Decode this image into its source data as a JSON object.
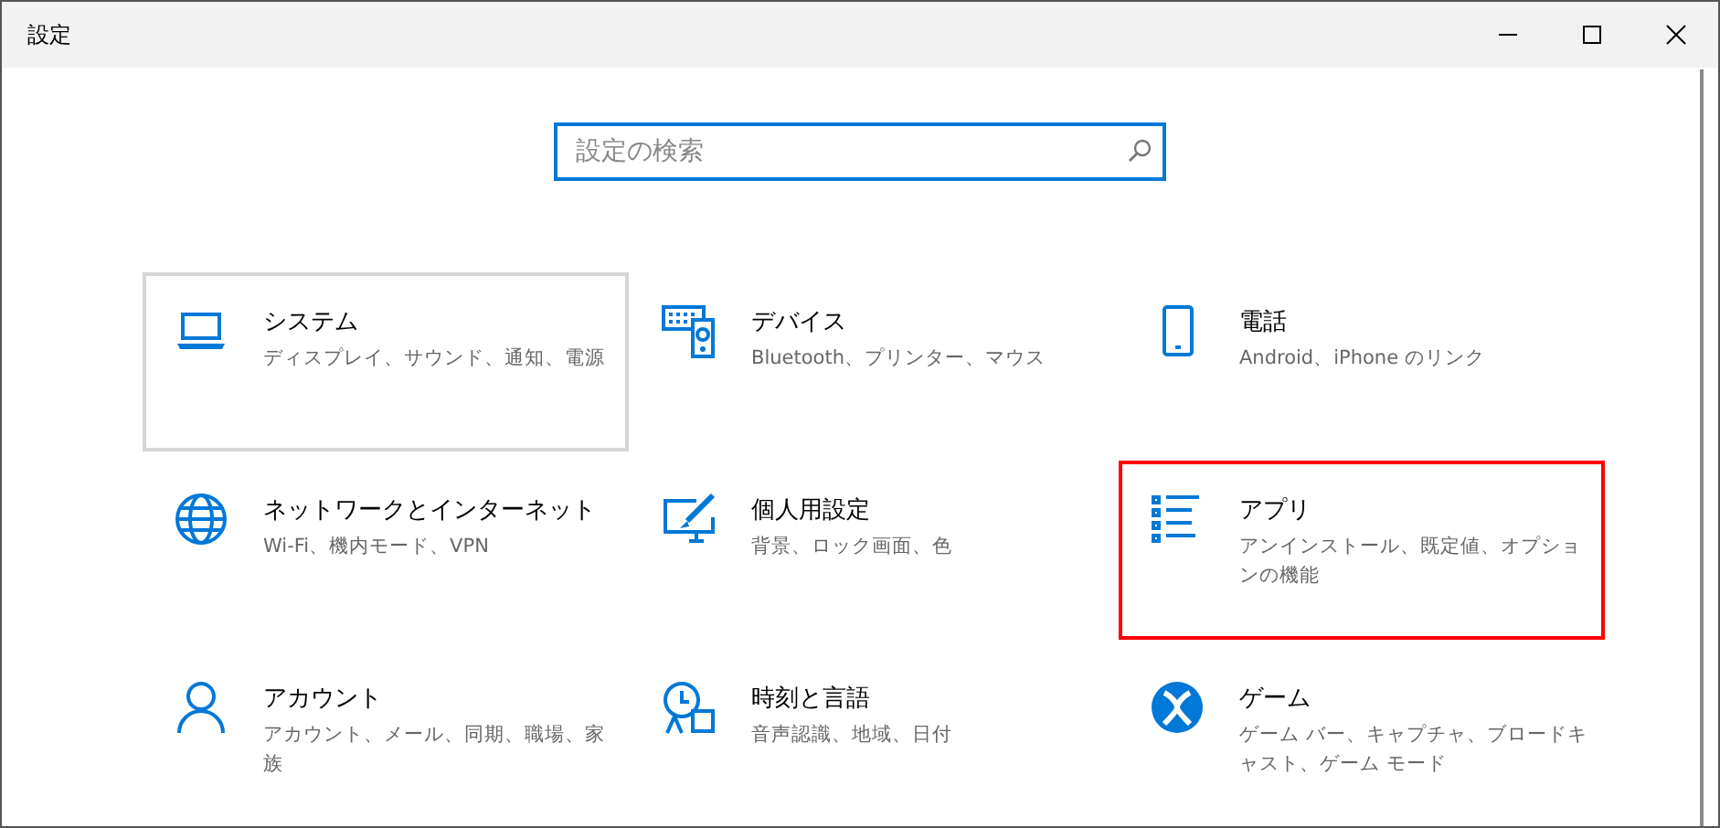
{
  "window": {
    "title": "設定"
  },
  "search": {
    "placeholder": "設定の検索"
  },
  "tiles": [
    {
      "title": "システム",
      "description": "ディスプレイ、サウンド、通知、電源",
      "hovered": true,
      "highlighted": false
    },
    {
      "title": "デバイス",
      "description": "Bluetooth、プリンター、マウス",
      "hovered": false,
      "highlighted": false
    },
    {
      "title": "電話",
      "description": "Android、iPhone のリンク",
      "hovered": false,
      "highlighted": false
    },
    {
      "title": "ネットワークとインターネット",
      "description": "Wi-Fi、機内モード、VPN",
      "hovered": false,
      "highlighted": false
    },
    {
      "title": "個人用設定",
      "description": "背景、ロック画面、色",
      "hovered": false,
      "highlighted": false
    },
    {
      "title": "アプリ",
      "description": "アンインストール、既定値、オプションの機能",
      "hovered": false,
      "highlighted": true
    },
    {
      "title": "アカウント",
      "description": "アカウント、メール、同期、職場、家族",
      "hovered": false,
      "highlighted": false
    },
    {
      "title": "時刻と言語",
      "description": "音声認識、地域、日付",
      "hovered": false,
      "highlighted": false
    },
    {
      "title": "ゲーム",
      "description": "ゲーム バー、キャプチャ、ブロードキャスト、ゲーム モード",
      "hovered": false,
      "highlighted": false
    }
  ]
}
